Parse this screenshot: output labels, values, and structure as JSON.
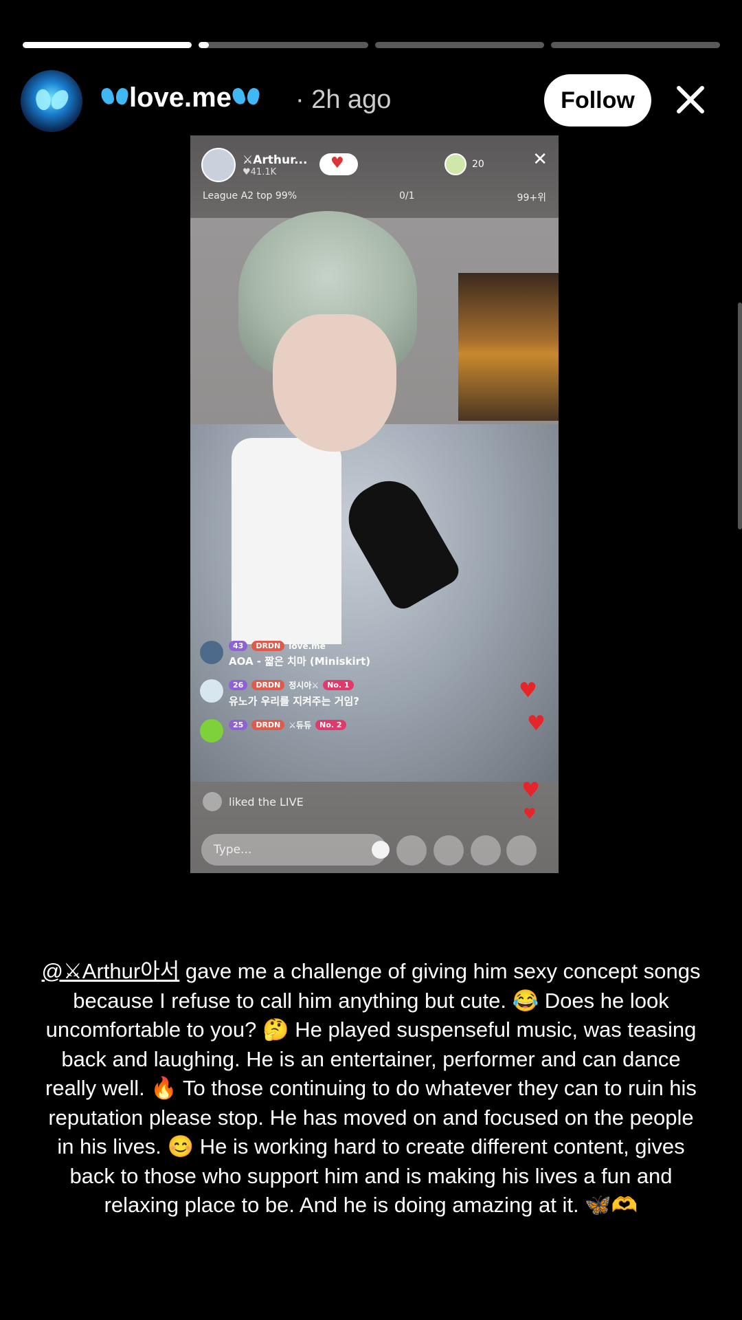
{
  "progress": [
    1.0,
    0.06,
    0.0,
    0.0
  ],
  "header": {
    "username": "love.me",
    "time": "· 2h ago",
    "follow_label": "Follow"
  },
  "live": {
    "host_name": "⚔Arthur...",
    "host_likes": "♥41.1K",
    "viewer_count": "20",
    "league": "League A2 top 99%",
    "progress_text": "0/1",
    "rank_text": "99+위",
    "comments": [
      {
        "level": "43",
        "tag": "DRDN",
        "user": "love.me",
        "text": "AOA - 짧은 치마 (Miniskirt)"
      },
      {
        "level": "26",
        "tag": "DRDN",
        "user": "정시아⚔",
        "rank": "No. 1",
        "text": "유노가 우리를 지켜주는 거임?"
      },
      {
        "level": "25",
        "tag": "DRDN",
        "user": "⚔듀듀",
        "rank": "No. 2",
        "text": ""
      }
    ],
    "liked_text": "liked the LIVE",
    "input_placeholder": "Type..."
  },
  "caption": {
    "mention": "@⚔Arthur아서",
    "text": " gave me a challenge of giving him sexy concept songs because I refuse to call him anything but cute. 😂 Does he look uncomfortable to you? 🤔 He played suspenseful music, was teasing back and laughing. He is an entertainer, performer and can dance really well. 🔥 To those continuing to do whatever they can to ruin his reputation please stop. He has moved on and focused on the people in his lives. 😊 He is working hard to create different content, gives back to those who support him and is making his lives a fun and relaxing place to be. And he is doing amazing at it. 🦋🫶"
  },
  "colors": {
    "accent_blue": "#3fb8f5",
    "heart_red": "#e5252a"
  }
}
